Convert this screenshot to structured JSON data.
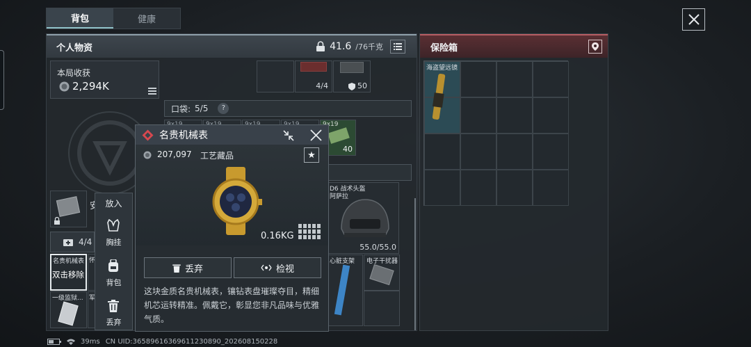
{
  "tabs": [
    {
      "label": "背包"
    },
    {
      "label": "健康"
    }
  ],
  "personal": {
    "title": "个人物资",
    "weight_value": "41.6",
    "weight_limit": "/76千克"
  },
  "income": {
    "label": "本局收获",
    "value": "2,294K"
  },
  "grid": {
    "top_item_count": "4/4",
    "top_item_ammo": "50",
    "pocket_label": "口袋:",
    "pocket_value": "5/5",
    "pocket_help": "?",
    "ammo_count": "40",
    "ammo_tags": [
      "9x19",
      "9x19",
      "9x19",
      "9x19",
      "9x19"
    ],
    "helmet_name": "D6 战术头盔",
    "helmet_sub": "阿萨拉",
    "helmet_durability": "55.0/55.0",
    "item_chest_rig": "心脏支架",
    "item_jammer": "电子干扰器",
    "left_count": "4/4",
    "left_item_label": "名贵机械表",
    "left_item_hint": "双击移除",
    "left_item2_label": "怀",
    "left_item3_label": "一级监狱...",
    "left_item4_label": "军",
    "left_truncated": "安"
  },
  "side_menu": {
    "title": "放入",
    "items": [
      {
        "label": "胸挂",
        "icon": "vest-icon"
      },
      {
        "label": "背包",
        "icon": "backpack-icon"
      },
      {
        "label": "丢弃",
        "icon": "trash-icon"
      }
    ]
  },
  "popup": {
    "title": "名贵机械表",
    "price": "207,097",
    "category": "工艺藏品",
    "weight": "0.16KG",
    "discard_label": "丢弃",
    "inspect_label": "检视",
    "description": "这块金质名贵机械表，镶钻表盘璀璨夺目，精细机芯运转精准。佩戴它，彰显您非凡品味与优雅气质。"
  },
  "safe": {
    "title": "保险箱",
    "item_label": "海盗望远镜"
  },
  "footer": {
    "ping": "39ms",
    "uid": "CN UID:3658961636961123089​0_202608150228"
  },
  "colors": {
    "accent_teal": "#8fc1c8",
    "safe_red": "#b65d63",
    "rarity_red": "#d8484f",
    "gold": "#d4a93a"
  }
}
